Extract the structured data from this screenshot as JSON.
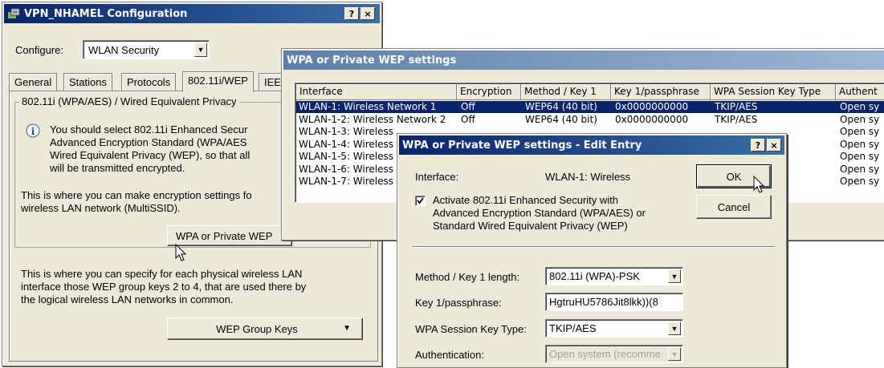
{
  "config_window": {
    "title": "VPN_NHAMEL Configuration",
    "help_btn": "?",
    "close_btn": "×",
    "configure_label": "Configure:",
    "configure_value": "WLAN Security",
    "tabs": [
      "General",
      "Stations",
      "Protocols",
      "802.11i/WEP",
      "IEE"
    ],
    "group_title": "802.11i (WPA/AES) / Wired Equivalent Privacy",
    "info_lines": [
      "You should select 802.11i Enhanced Secur",
      "Advanced Encryption Standard (WPA/AES",
      "Wired Equivalent Privacy (WEP), so that all",
      "will be transmitted encrypted."
    ],
    "desc1_lines": [
      "This is where you can make encryption settings fo",
      "wireless LAN network (MultiSSID)."
    ],
    "wpa_button": "WPA or Private WEP",
    "desc2_lines": [
      "This is where you can specify for each physical wireless LAN",
      "interface those WEP group keys 2 to 4, that are used there by",
      "the logical wireless LAN networks in common."
    ],
    "wep_group_button": "WEP Group Keys"
  },
  "list_window": {
    "title": "WPA or Private WEP settings",
    "columns": [
      "Interface",
      "Encryption",
      "Method / Key 1",
      "Key 1/passphrase",
      "WPA Session Key Type",
      "Authent"
    ],
    "rows": [
      {
        "interface": "WLAN-1: Wireless Network 1",
        "encryption": "Off",
        "method": "WEP64 (40 bit)",
        "key": "0x0000000000",
        "session": "TKIP/AES",
        "auth": "Open sy"
      },
      {
        "interface": "WLAN-1-2: Wireless Network 2",
        "encryption": "Off",
        "method": "WEP64 (40 bit)",
        "key": "0x0000000000",
        "session": "TKIP/AES",
        "auth": "Open sy"
      },
      {
        "interface": "WLAN-1-3: Wireless",
        "encryption": "",
        "method": "",
        "key": "",
        "session": "",
        "auth": "Open sy"
      },
      {
        "interface": "WLAN-1-4: Wireless",
        "encryption": "",
        "method": "",
        "key": "",
        "session": "",
        "auth": "Open sy"
      },
      {
        "interface": "WLAN-1-5: Wireless",
        "encryption": "",
        "method": "",
        "key": "",
        "session": "",
        "auth": "Open sy"
      },
      {
        "interface": "WLAN-1-6: Wireless",
        "encryption": "",
        "method": "",
        "key": "",
        "session": "",
        "auth": "Open sy"
      },
      {
        "interface": "WLAN-1-7: Wireless",
        "encryption": "",
        "method": "",
        "key": "",
        "session": "",
        "auth": "Open sy"
      }
    ]
  },
  "edit_dialog": {
    "title": "WPA or Private WEP settings - Edit Entry",
    "help_btn": "?",
    "close_btn": "×",
    "interface_label": "Interface:",
    "interface_value": "WLAN-1: Wireless",
    "ok": "OK",
    "cancel": "Cancel",
    "activate_lines": [
      "Activate 802.11i Enhanced Security with",
      "Advanced Encryption Standard (WPA/AES) or",
      "Standard Wired Equivalent Privacy (WEP)"
    ],
    "activate_checked": true,
    "method_label": "Method / Key 1 length:",
    "method_value": "802.11i (WPA)-PSK",
    "key_label": "Key 1/passphrase:",
    "key_value": "HgtruHU5786Jit8lkk))(8",
    "session_label": "WPA Session Key Type:",
    "session_value": "TKIP/AES",
    "auth_label": "Authentication:",
    "auth_value": "Open system (recomme"
  }
}
